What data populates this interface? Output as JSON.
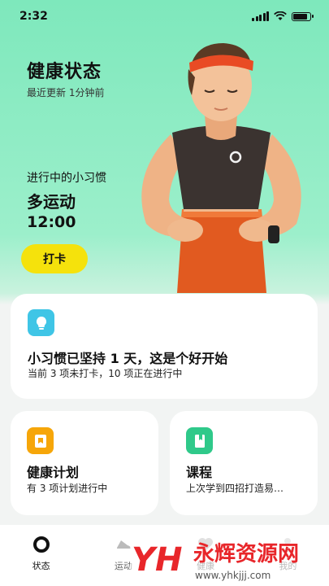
{
  "status_bar": {
    "time": "2:32"
  },
  "hero": {
    "title": "健康状态",
    "subtitle": "最近更新 1分钟前",
    "habit_label": "进行中的小习惯",
    "habit_name": "多运动",
    "habit_time": "12:00",
    "checkin_label": "打卡"
  },
  "habit_card": {
    "icon": "lightbulb-icon",
    "title": "小习惯已坚持 1 天，这是个好开始",
    "description": "当前 3 项未打卡，10 项正在进行中"
  },
  "plan_card": {
    "icon": "bookmark-icon",
    "title": "健康计划",
    "description": "有 3 项计划进行中"
  },
  "course_card": {
    "icon": "book-icon",
    "title": "课程",
    "description": "上次学到四招打造易…"
  },
  "tabs": [
    {
      "label": "状态",
      "icon": "ring-icon",
      "active": true
    },
    {
      "label": "运动",
      "icon": "shoe-icon",
      "active": false
    },
    {
      "label": "健康",
      "icon": "heart-icon",
      "active": false
    },
    {
      "label": "我的",
      "icon": "person-icon",
      "active": false
    }
  ],
  "watermark": {
    "logo_text": "YH",
    "title": "永辉资源网",
    "url": "www.yhkjjj.com"
  },
  "colors": {
    "hero_bg": "#7ee8bc",
    "checkin_button": "#f5e20c",
    "habit_icon": "#3fc5e6",
    "plan_icon": "#f6a609",
    "course_icon": "#2fc98a",
    "watermark_red": "#e8262a"
  }
}
